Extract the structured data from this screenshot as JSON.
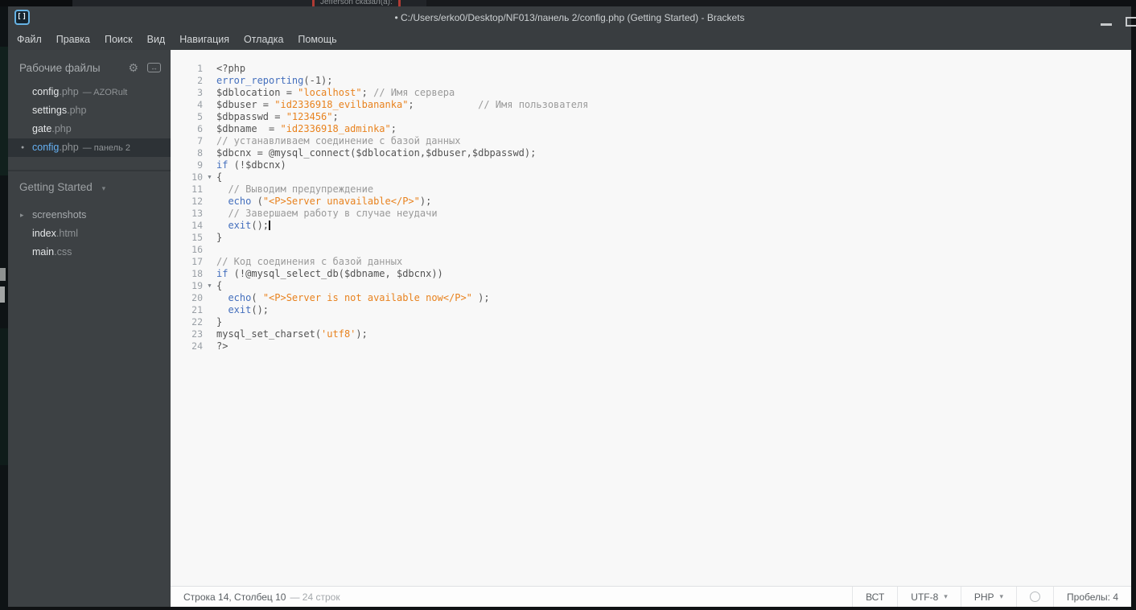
{
  "background": {
    "snippet": "Jefferson сказал(а):"
  },
  "window": {
    "title": "• C:/Users/erko0/Desktop/NF013/панель 2/config.php (Getting Started) - Brackets",
    "logo_glyph": "[]"
  },
  "menu": {
    "items": [
      "Файл",
      "Правка",
      "Поиск",
      "Вид",
      "Навигация",
      "Отладка",
      "Помощь"
    ]
  },
  "sidebar": {
    "working_files": {
      "title": "Рабочие файлы",
      "files": [
        {
          "name": "config",
          "ext": ".php",
          "suffix": "— AZORult",
          "active": false,
          "dirty": false
        },
        {
          "name": "settings",
          "ext": ".php",
          "suffix": "",
          "active": false,
          "dirty": false
        },
        {
          "name": "gate",
          "ext": ".php",
          "suffix": "",
          "active": false,
          "dirty": false
        },
        {
          "name": "config",
          "ext": ".php",
          "suffix": "— панель 2",
          "active": true,
          "dirty": true
        }
      ]
    },
    "project": {
      "name": "Getting Started",
      "items": [
        {
          "name": "screenshots",
          "ext": "",
          "folder": true
        },
        {
          "name": "index",
          "ext": ".html",
          "folder": false
        },
        {
          "name": "main",
          "ext": ".css",
          "folder": false
        }
      ]
    }
  },
  "editor": {
    "cursor_line": 14,
    "colors": {
      "keyword": "#446fbd",
      "string": "#e8821e",
      "comment": "#9a9a9a",
      "default": "#535353"
    },
    "lines": [
      {
        "n": 1,
        "fold": false,
        "seg": [
          [
            "d",
            "<?php"
          ]
        ]
      },
      {
        "n": 2,
        "fold": false,
        "seg": [
          [
            "k",
            "error_reporting"
          ],
          [
            "d",
            "(-1);"
          ]
        ]
      },
      {
        "n": 3,
        "fold": false,
        "seg": [
          [
            "d",
            "$dblocation = "
          ],
          [
            "s",
            "\"localhost\""
          ],
          [
            "d",
            "; "
          ],
          [
            "c",
            "// Имя сервера"
          ]
        ]
      },
      {
        "n": 4,
        "fold": false,
        "seg": [
          [
            "d",
            "$dbuser = "
          ],
          [
            "s",
            "\"id2336918_evilbananka\""
          ],
          [
            "d",
            ";           "
          ],
          [
            "c",
            "// Имя пользователя"
          ]
        ]
      },
      {
        "n": 5,
        "fold": false,
        "seg": [
          [
            "d",
            "$dbpasswd = "
          ],
          [
            "s",
            "\"123456\""
          ],
          [
            "d",
            ";"
          ]
        ]
      },
      {
        "n": 6,
        "fold": false,
        "seg": [
          [
            "d",
            "$dbname  = "
          ],
          [
            "s",
            "\"id2336918_adminka\""
          ],
          [
            "d",
            ";"
          ]
        ]
      },
      {
        "n": 7,
        "fold": false,
        "seg": [
          [
            "c",
            "// устанавливаем соединение с базой данных"
          ]
        ]
      },
      {
        "n": 8,
        "fold": false,
        "seg": [
          [
            "d",
            "$dbcnx = @mysql_connect($dblocation,$dbuser,$dbpasswd);"
          ]
        ]
      },
      {
        "n": 9,
        "fold": false,
        "seg": [
          [
            "k",
            "if"
          ],
          [
            "d",
            " (!$dbcnx)"
          ]
        ]
      },
      {
        "n": 10,
        "fold": true,
        "seg": [
          [
            "d",
            "{"
          ]
        ]
      },
      {
        "n": 11,
        "fold": false,
        "seg": [
          [
            "d",
            "  "
          ],
          [
            "c",
            "// Выводим предупреждение"
          ]
        ]
      },
      {
        "n": 12,
        "fold": false,
        "seg": [
          [
            "d",
            "  "
          ],
          [
            "k",
            "echo"
          ],
          [
            "d",
            " ("
          ],
          [
            "s",
            "\"<P>Server unavailable</P>\""
          ],
          [
            "d",
            ");"
          ]
        ]
      },
      {
        "n": 13,
        "fold": false,
        "seg": [
          [
            "d",
            "  "
          ],
          [
            "c",
            "// Завершаем работу в случае неудачи"
          ]
        ]
      },
      {
        "n": 14,
        "fold": false,
        "seg": [
          [
            "d",
            "  "
          ],
          [
            "k",
            "exit"
          ],
          [
            "d",
            "();"
          ]
        ]
      },
      {
        "n": 15,
        "fold": false,
        "seg": [
          [
            "d",
            "}"
          ]
        ]
      },
      {
        "n": 16,
        "fold": false,
        "seg": []
      },
      {
        "n": 17,
        "fold": false,
        "seg": [
          [
            "c",
            "// Код соединения с базой данных"
          ]
        ]
      },
      {
        "n": 18,
        "fold": false,
        "seg": [
          [
            "k",
            "if"
          ],
          [
            "d",
            " (!@mysql_select_db($dbname, $dbcnx))"
          ]
        ]
      },
      {
        "n": 19,
        "fold": true,
        "seg": [
          [
            "d",
            "{"
          ]
        ]
      },
      {
        "n": 20,
        "fold": false,
        "seg": [
          [
            "d",
            "  "
          ],
          [
            "k",
            "echo"
          ],
          [
            "d",
            "( "
          ],
          [
            "s",
            "\"<P>Server is not available now</P>\""
          ],
          [
            "d",
            " );"
          ]
        ]
      },
      {
        "n": 21,
        "fold": false,
        "seg": [
          [
            "d",
            "  "
          ],
          [
            "k",
            "exit"
          ],
          [
            "d",
            "();"
          ]
        ]
      },
      {
        "n": 22,
        "fold": false,
        "seg": [
          [
            "d",
            "}"
          ]
        ]
      },
      {
        "n": 23,
        "fold": false,
        "seg": [
          [
            "d",
            "mysql_set_charset("
          ],
          [
            "s",
            "'utf8'"
          ],
          [
            "d",
            ");"
          ]
        ]
      },
      {
        "n": 24,
        "fold": false,
        "seg": [
          [
            "d",
            "?>"
          ]
        ]
      }
    ]
  },
  "statusbar": {
    "position": "Строка 14, Столбец 10",
    "lines_info": "— 24 строк",
    "overwrite": "ВСТ",
    "encoding": "UTF-8",
    "language": "PHP",
    "spaces": "Пробелы: 4"
  }
}
